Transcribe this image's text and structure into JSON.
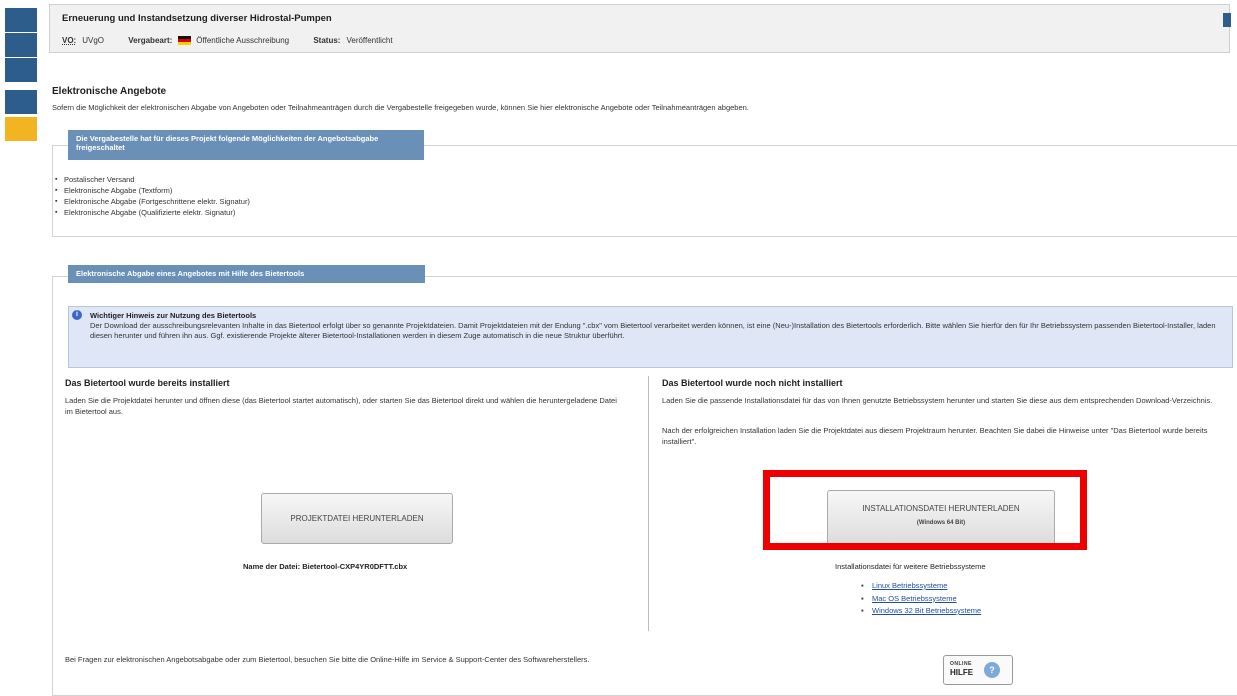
{
  "header": {
    "title": "Erneuerung und Instandsetzung diverser Hidrostal-Pumpen",
    "vo_label": "VO:",
    "vo_value": "UVgO",
    "vergabeart_label": "Vergabeart:",
    "vergabeart_value": "Öffentliche Ausschreibung",
    "status_label": "Status:",
    "status_value": "Veröffentlicht"
  },
  "section": {
    "title": "Elektronische Angebote",
    "intro": "Sofern die Möglichkeit der elektronischen Abgabe von Angeboten oder Teilnahmeanträgen durch die Vergabestelle freigegeben wurde, können Sie hier elektronische Angebote oder Teilnahmeanträgen abgeben."
  },
  "options": {
    "legend": "Die Vergabestelle hat für dieses Projekt folgende Möglichkeiten der Angebotsabgabe freigeschaltet",
    "items": [
      "Postalischer Versand",
      "Elektronische Abgabe (Textform)",
      "Elektronische Abgabe (Fortgeschrittene elektr. Signatur)",
      "Elektronische Abgabe (Qualifizierte elektr. Signatur)"
    ]
  },
  "biettertool": {
    "legend": "Elektronische Abgabe eines Angebotes mit Hilfe des Bietertools",
    "notice_title": "Wichtiger Hinweis zur Nutzung des Bietertools",
    "notice_text": "Der Download der ausschreibungsrelevanten Inhalte in das Bietertool erfolgt über so genannte Projektdateien. Damit Projektdateien mit der Endung \".cbx\" vom Bietertool verarbeitet werden können, ist eine (Neu-)Installation des Bietertools erforderlich. Bitte wählen Sie hierfür den für Ihr Betriebssystem passenden Bietertool-Installer, laden diesen herunter und führen ihn aus. Ggf. existierende Projekte älterer Bietertool-Installationen werden in diesem Zuge automatisch in die neue Struktur überführt."
  },
  "left_col": {
    "title": "Das Bietertool wurde bereits installiert",
    "text": "Laden Sie die Projektdatei herunter und öffnen diese (das Bietertool startet automatisch), oder starten Sie das Bietertool direkt und wählen die heruntergeladene Datei im Bietertool aus.",
    "button": "PROJEKTDATEI HERUNTERLADEN",
    "filename_label": "Name der Datei:",
    "filename_value": "Bietertool-CXP4YR0DFTT.cbx"
  },
  "right_col": {
    "title": "Das Bietertool wurde noch nicht installiert",
    "text1": "Laden Sie die passende Installationsdatei für das von Ihnen genutzte Betriebssystem herunter und starten Sie diese aus dem entsprechenden Download-Verzeichnis.",
    "text2": "Nach der erfolgreichen Installation laden Sie die Projektdatei aus diesem Projektraum herunter. Beachten Sie dabei die Hinweise unter \"Das Bietertool wurde bereits installiert\".",
    "button": "INSTALLATIONSDATEI HERUNTERLADEN",
    "button_sub": "(Windows 64 Bit)",
    "other_title": "Installationsdatei für weitere Betriebssysteme",
    "links": [
      "Linux Betriebssysteme",
      "Mac OS Betriebssysteme",
      "Windows 32 Bit Betriebssysteme"
    ]
  },
  "footer": {
    "text": "Bei Fragen zur elektronischen Angebotsabgabe oder zum Bietertool, besuchen Sie bitte die Online-Hilfe im Service & Support-Center des Softwareherstellers.",
    "badge_top": "ONLINE",
    "badge_main": "HILFE"
  },
  "colors": {
    "rail": "#2d5d8a",
    "rail_accent": "#f2b420",
    "legend_bg": "#6a90b8",
    "highlight": "#ee0000"
  }
}
